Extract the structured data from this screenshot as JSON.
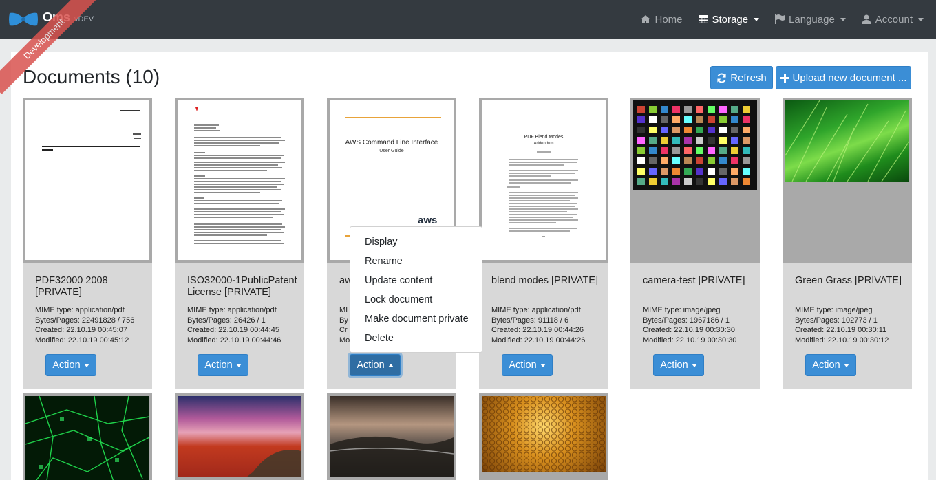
{
  "brand": {
    "name": "Oms",
    "version": "vDEV",
    "ribbon": "Development"
  },
  "nav": [
    {
      "label": "Home",
      "icon": "home-icon"
    },
    {
      "label": "Storage",
      "icon": "table-icon",
      "active": true
    },
    {
      "label": "Language",
      "icon": "flag-icon"
    },
    {
      "label": "Account",
      "icon": "user-icon"
    }
  ],
  "page": {
    "title": "Documents (10)",
    "refresh_label": "Refresh",
    "upload_label": "Upload new document ..."
  },
  "labels": {
    "action": "Action"
  },
  "cards": [
    {
      "title": "PDF32000 2008 [PRIVATE]",
      "mime": "MIME type: application/pdf",
      "bytes": "Bytes/Pages: 22491828 / 756",
      "created": "Created: 22.10.19 00:45:07",
      "modified": "Modified: 22.10.19 00:45:12"
    },
    {
      "title": "ISO32000-1PublicPatentLicense [PRIVATE]",
      "mime": "MIME type: application/pdf",
      "bytes": "Bytes/Pages: 26426 / 1",
      "created": "Created: 22.10.19 00:44:45",
      "modified": "Modified: 22.10.19 00:44:46"
    },
    {
      "title": "aw",
      "mime": "MI",
      "bytes": "By",
      "created": "Cr",
      "modified": "Mo"
    },
    {
      "title": "blend modes [PRIVATE]",
      "mime": "MIME type: application/pdf",
      "bytes": "Bytes/Pages: 91118 / 6",
      "created": "Created: 22.10.19 00:44:26",
      "modified": "Modified: 22.10.19 00:44:26"
    },
    {
      "title": "camera-test [PRIVATE]",
      "mime": "MIME type: image/jpeg",
      "bytes": "Bytes/Pages: 1967186 / 1",
      "created": "Created: 22.10.19 00:30:30",
      "modified": "Modified: 22.10.19 00:30:30"
    },
    {
      "title": "Green Grass [PRIVATE]",
      "mime": "MIME type: image/jpeg",
      "bytes": "Bytes/Pages: 102773 / 1",
      "created": "Created: 22.10.19 00:30:11",
      "modified": "Modified: 22.10.19 00:30:12"
    }
  ],
  "thumb_text": {
    "aws_title": "AWS Command Line Interface",
    "aws_subtitle": "User Guide",
    "aws_logo": "aws",
    "blend_title": "PDF Blend Modes",
    "blend_subtitle": "Addendum"
  },
  "dropdown": [
    "Display",
    "Rename",
    "Update content",
    "Lock document",
    "Make document private",
    "Delete"
  ],
  "colors": {
    "navbar": "#343a40",
    "primary": "#3b8ed6",
    "card": "#d8d8d8",
    "ribbon": "#d9534f"
  }
}
